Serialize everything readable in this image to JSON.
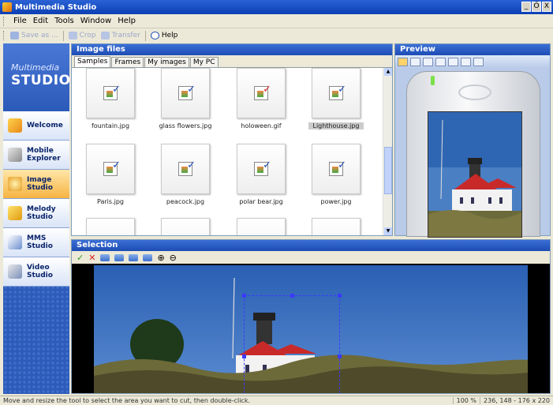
{
  "window": {
    "title": "Multimedia Studio",
    "controls": [
      "_",
      "Ő",
      "X"
    ]
  },
  "menu": [
    "File",
    "Edit",
    "Tools",
    "Window",
    "Help"
  ],
  "toolbar": [
    {
      "label": "Save as ...",
      "icon": "save-icon",
      "enabled": false
    },
    {
      "label": "Crop",
      "icon": "crop-icon",
      "enabled": false
    },
    {
      "label": "Transfer",
      "icon": "transfer-icon",
      "enabled": false
    },
    {
      "label": "Help",
      "icon": "help-icon",
      "enabled": true
    }
  ],
  "brand": {
    "line1": "Multimedia",
    "line2": "STUDIO"
  },
  "nav": [
    {
      "label": "Welcome",
      "icon": "welcome-icon",
      "active": false
    },
    {
      "label": "Mobile Explorer",
      "icon": "mobile-explorer-icon",
      "active": false
    },
    {
      "label": "Image Studio",
      "icon": "image-studio-icon",
      "active": true
    },
    {
      "label": "Melody Studio",
      "icon": "melody-studio-icon",
      "active": false
    },
    {
      "label": "MMS Studio",
      "icon": "mms-studio-icon",
      "active": false
    },
    {
      "label": "Video Studio",
      "icon": "video-studio-icon",
      "active": false
    }
  ],
  "image_files": {
    "title": "Image files",
    "tabs": [
      "Samples",
      "Frames",
      "My images",
      "My PC"
    ],
    "active_tab": 0,
    "files": [
      "fountain.jpg",
      "glass flowers.jpg",
      "holoween.gif",
      "Lighthouse.jpg",
      "Paris.jpg",
      "peacock.jpg",
      "polar bear.jpg",
      "power.jpg"
    ],
    "selected_file": 3
  },
  "preview": {
    "title": "Preview"
  },
  "selection": {
    "title": "Selection"
  },
  "status": {
    "message": "Move and resize the tool to select the area you want to cut, then double-click.",
    "zoom": "100 %",
    "coords": "236, 148 - 176 x 220"
  },
  "colors": {
    "panel_header": "#1c4cb4",
    "nav_active": "#f6b443",
    "selection_rect": "#3a3aff"
  }
}
